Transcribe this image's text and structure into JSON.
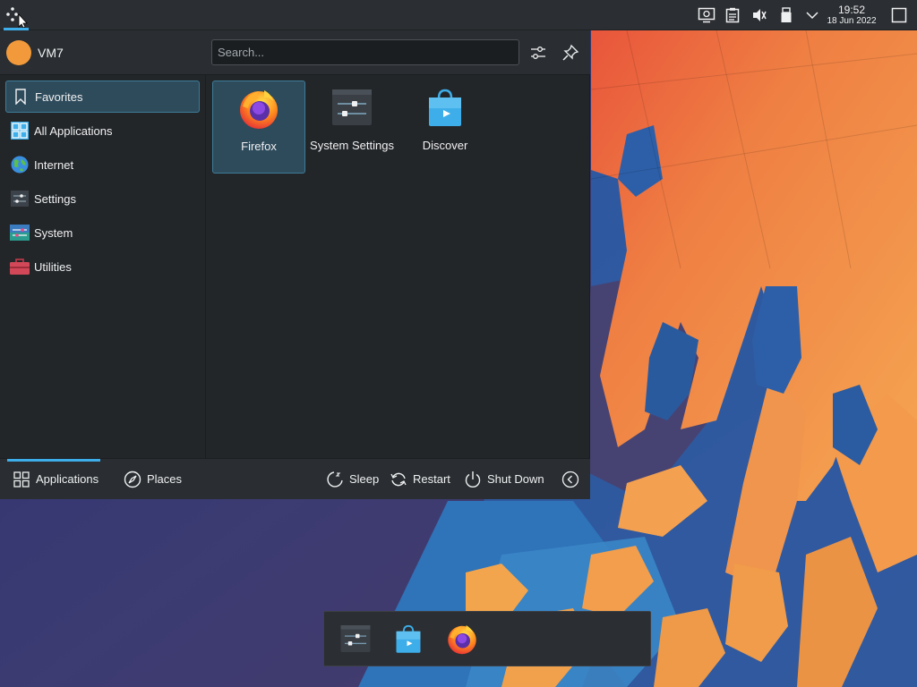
{
  "panel": {
    "launcher_icon": "kde-application-launcher-icon",
    "tray_icons": [
      "screen-display-icon",
      "clipboard-icon",
      "audio-muted-icon",
      "usb-drive-icon",
      "chevron-down-icon"
    ],
    "clock": {
      "time": "19:52",
      "date": "18 Jun 2022"
    },
    "show_desktop_icon": "show-desktop-icon"
  },
  "kickoff": {
    "user": {
      "name": "VM7",
      "avatar_color": "#f29a3b"
    },
    "search": {
      "placeholder": "Search...",
      "value": ""
    },
    "header_buttons": [
      "configure-icon",
      "pin-icon"
    ],
    "categories": [
      {
        "label": "Favorites",
        "icon": "bookmark-icon",
        "active": true
      },
      {
        "label": "All Applications",
        "icon": "all-apps-grid-icon",
        "active": false
      },
      {
        "label": "Internet",
        "icon": "globe-icon",
        "active": false
      },
      {
        "label": "Settings",
        "icon": "settings-icon",
        "active": false
      },
      {
        "label": "System",
        "icon": "system-icon",
        "active": false
      },
      {
        "label": "Utilities",
        "icon": "toolbox-icon",
        "active": false
      }
    ],
    "apps": [
      {
        "label": "Firefox",
        "icon": "firefox-icon",
        "active": true
      },
      {
        "label": "System Settings",
        "icon": "system-settings-icon",
        "active": false
      },
      {
        "label": "Discover",
        "icon": "discover-icon",
        "active": false
      }
    ],
    "footer": {
      "tabs": [
        {
          "label": "Applications",
          "icon": "applications-grid-icon",
          "active": true
        },
        {
          "label": "Places",
          "icon": "compass-icon",
          "active": false
        }
      ],
      "actions": [
        {
          "label": "Sleep",
          "icon": "sleep-icon"
        },
        {
          "label": "Restart",
          "icon": "restart-icon"
        },
        {
          "label": "Shut Down",
          "icon": "shutdown-icon"
        }
      ],
      "more_icon": "chevron-left-icon"
    }
  },
  "dock": {
    "items": [
      "system-settings-icon",
      "discover-icon",
      "firefox-icon"
    ]
  },
  "colors": {
    "accent": "#3daee9",
    "panel_bg": "#2b2e32",
    "menu_bg": "#232629",
    "selection_bg": "#2e4b5c",
    "wallpaper_orange": "#f0954d",
    "wallpaper_blue": "#2f6fb0"
  }
}
